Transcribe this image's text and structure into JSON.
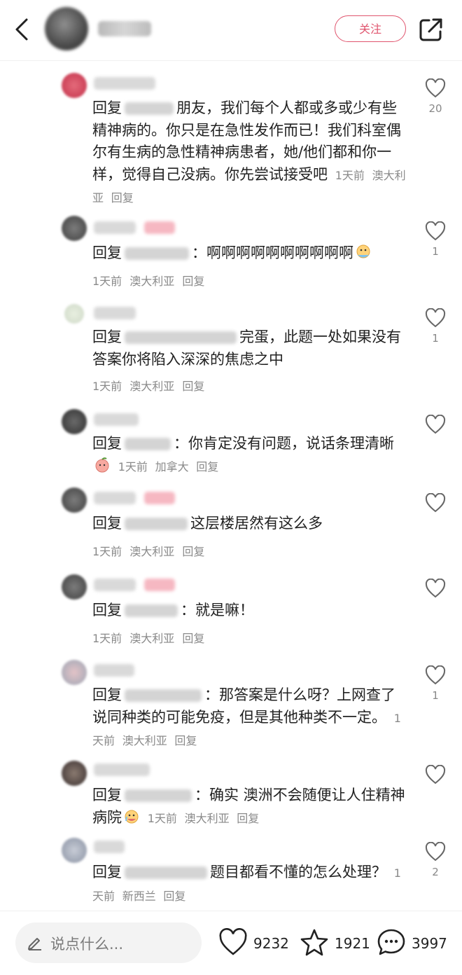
{
  "header": {
    "follow_label": "关注"
  },
  "comments": [
    {
      "text_before": "回复",
      "text": "朋友，我们每个人都或多或少有些精神病的。你只是在急性发作而已！我们科室偶尔有生病的急性精神病患者，她/他们都和你一样，觉得自己没病。你先尝试接受吧",
      "time": "1天前",
      "location": "澳大利亚",
      "reply": "回复",
      "likes": "20"
    },
    {
      "text_before": "回复",
      "text": "：啊啊啊啊啊啊啊啊啊啊",
      "time": "1天前",
      "location": "澳大利亚",
      "reply": "回复",
      "likes": "1"
    },
    {
      "text_before": "回复",
      "text": "完蛋，此题一处如果没有答案你将陷入深深的焦虑之中",
      "time": "1天前",
      "location": "澳大利亚",
      "reply": "回复",
      "likes": "1"
    },
    {
      "text_before": "回复",
      "text": "：你肯定没有问题，说话条理清晰",
      "time": "1天前",
      "location": "加拿大",
      "reply": "回复",
      "likes": ""
    },
    {
      "text_before": "回复",
      "text": "这层楼居然有这么多",
      "time": "1天前",
      "location": "澳大利亚",
      "reply": "回复",
      "likes": ""
    },
    {
      "text_before": "回复",
      "text": "：就是嘛！",
      "time": "1天前",
      "location": "澳大利亚",
      "reply": "回复",
      "likes": ""
    },
    {
      "text_before": "回复",
      "text": "：那答案是什么呀？上网查了说同种类的可能免疫，但是其他种类不一定。",
      "time": "1天前",
      "location": "澳大利亚",
      "reply": "回复",
      "likes": "1"
    },
    {
      "text_before": "回复",
      "text": "：确实 澳洲不会随便让人住精神病院",
      "time": "1天前",
      "location": "澳大利亚",
      "reply": "回复",
      "likes": ""
    },
    {
      "text_before": "回复",
      "text": "题目都看不懂的怎么处理？",
      "time": "1天前",
      "location": "新西兰",
      "reply": "回复",
      "likes": "2"
    }
  ],
  "bottom": {
    "input_placeholder": "说点什么...",
    "likes": "9232",
    "favorites": "1921",
    "comments": "3997"
  },
  "colors": {
    "accent": "#e0556e",
    "meta": "#8a8a8a"
  }
}
